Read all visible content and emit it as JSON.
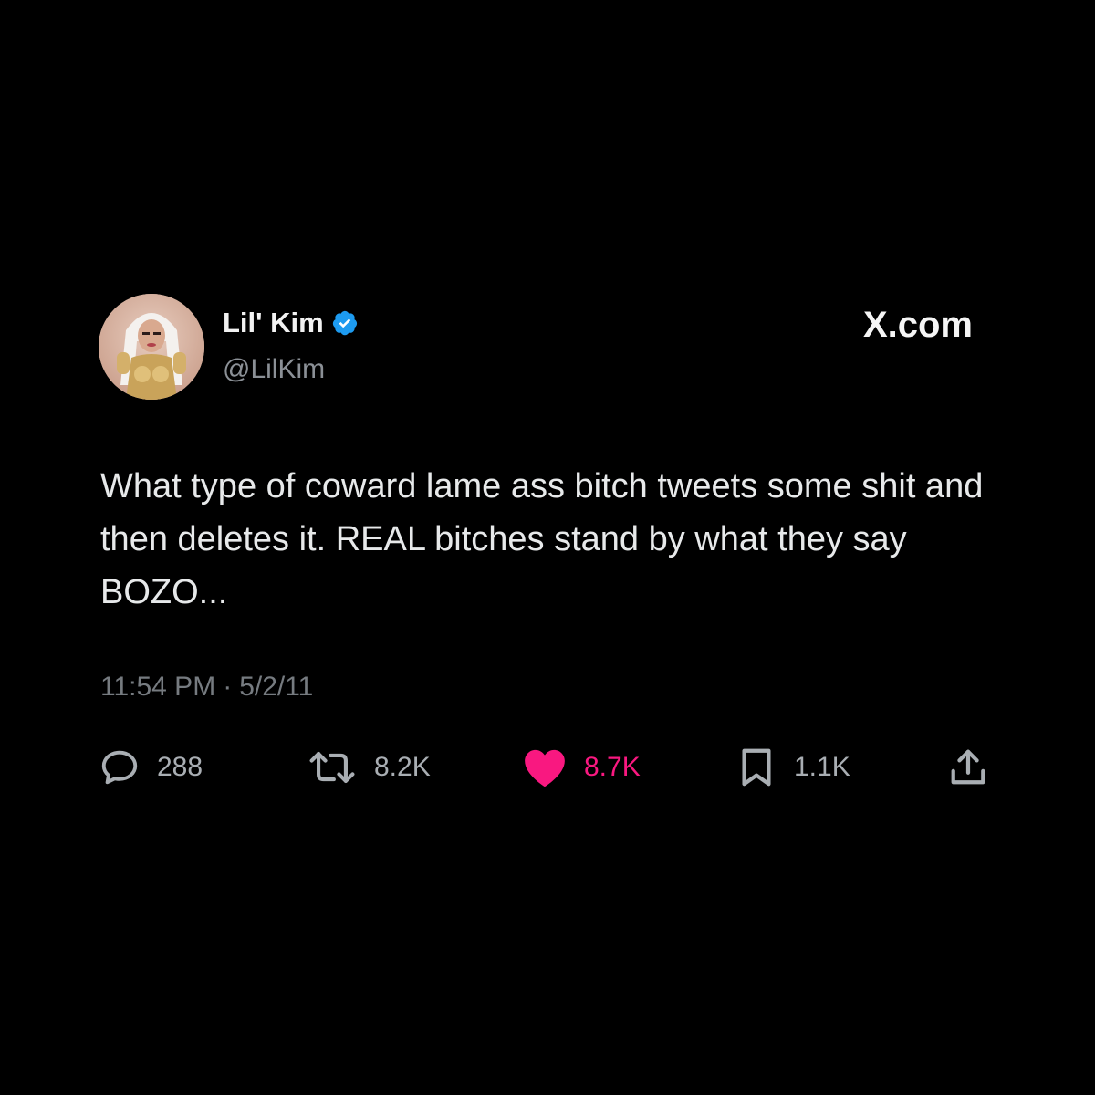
{
  "tweet": {
    "display_name": "Lil' Kim",
    "handle": "@LilKim",
    "verified": true,
    "brand": "X.com",
    "text": "What type of coward lame ass bitch tweets some shit and then deletes it. REAL bitches stand by what they say BOZO...",
    "time": "11:54 PM",
    "separator": "·",
    "date": "5/2/11"
  },
  "actions": {
    "replies": "288",
    "reposts": "8.2K",
    "likes": "8.7K",
    "bookmarks": "1.1K"
  },
  "colors": {
    "background": "#000000",
    "verified_blue": "#1d9bf0",
    "like_pink": "#f91880",
    "secondary_text": "#8b9096"
  },
  "icons": {
    "verified": "verified-badge-icon",
    "reply": "reply-icon",
    "repost": "repost-icon",
    "like": "heart-icon",
    "bookmark": "bookmark-icon",
    "share": "share-icon"
  }
}
